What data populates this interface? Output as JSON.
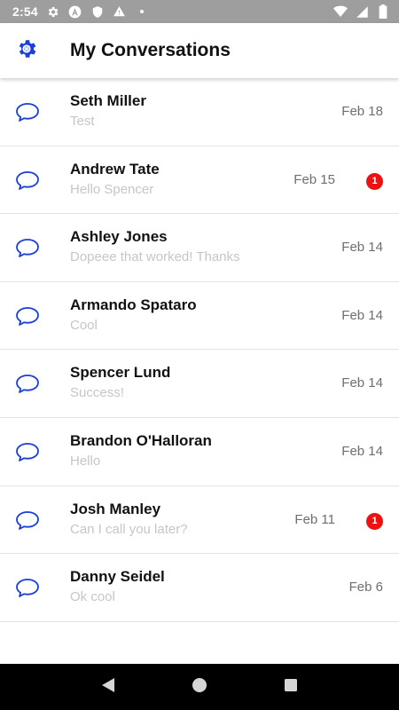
{
  "status_bar": {
    "time": "2:54",
    "left_icons": [
      "gear-icon",
      "app-a-icon",
      "shield-icon",
      "warning-icon",
      "dot-icon"
    ],
    "right_icons": [
      "wifi-icon",
      "cellular-icon",
      "battery-icon"
    ]
  },
  "header": {
    "title": "My Conversations",
    "settings_icon": "settings-gear-icon",
    "accent_color": "#1a3fd8"
  },
  "conversations": [
    {
      "name": "Seth Miller",
      "preview": "Test",
      "date": "Feb 18",
      "unread": null
    },
    {
      "name": "Andrew Tate",
      "preview": "Hello Spencer",
      "date": "Feb 15",
      "unread": "1"
    },
    {
      "name": "Ashley Jones",
      "preview": "Dopeee that worked! Thanks",
      "date": "Feb 14",
      "unread": null
    },
    {
      "name": "Armando Spataro",
      "preview": "Cool",
      "date": "Feb 14",
      "unread": null
    },
    {
      "name": "Spencer Lund",
      "preview": "Success!",
      "date": "Feb 14",
      "unread": null
    },
    {
      "name": "Brandon O'Halloran",
      "preview": "Hello",
      "date": "Feb 14",
      "unread": null
    },
    {
      "name": "Josh Manley",
      "preview": "Can I call you later?",
      "date": "Feb 11",
      "unread": "1"
    },
    {
      "name": "Danny Seidel",
      "preview": "Ok cool",
      "date": "Feb 6",
      "unread": null
    }
  ],
  "colors": {
    "status_bar_bg": "#9e9e9e",
    "badge": "#ee1111",
    "chat_icon": "#1a3fd8",
    "preview_text": "#c6c6c6",
    "date_text": "#6e6e6e"
  },
  "nav_bar": {
    "buttons": [
      "back-icon",
      "home-icon",
      "recents-icon"
    ]
  }
}
